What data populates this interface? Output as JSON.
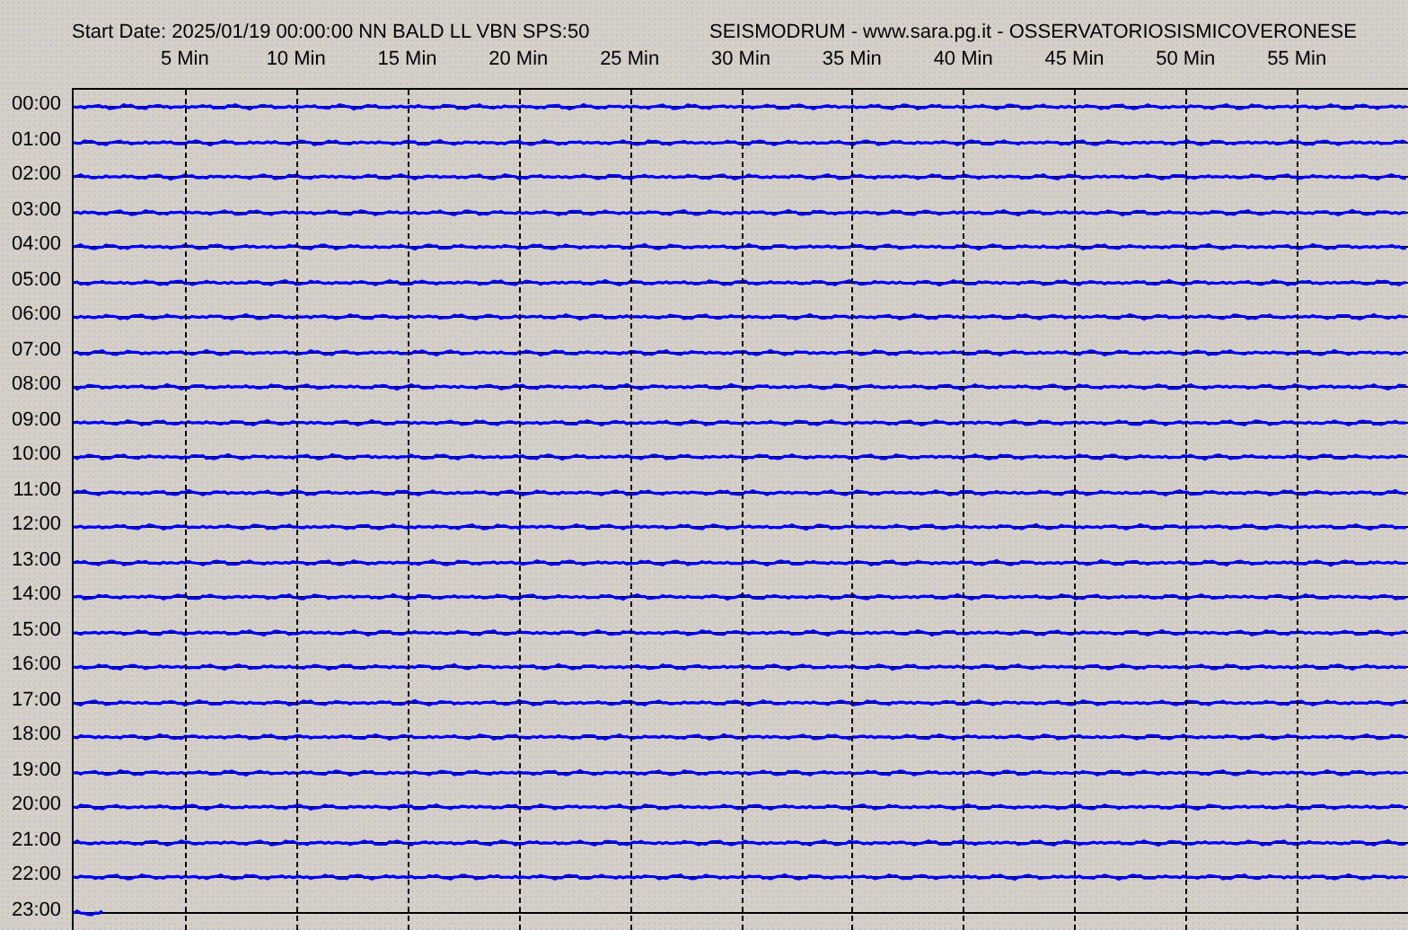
{
  "header": {
    "start_info": "Start Date: 2025/01/19 00:00:00 NN BALD LL VBN SPS:50",
    "title": "SEISMODRUM - www.sara.pg.it - OSSERVATORIOSISMICOVERONESE"
  },
  "minute_ticks": [
    "5 Min",
    "10 Min",
    "15 Min",
    "20 Min",
    "25 Min",
    "30 Min",
    "35 Min",
    "40 Min",
    "45 Min",
    "50 Min",
    "55 Min"
  ],
  "rows": [
    {
      "label": "00:00",
      "level": 1
    },
    {
      "label": "01:00",
      "level": 1
    },
    {
      "label": "02:00",
      "level": 1
    },
    {
      "label": "03:00",
      "level": 1
    },
    {
      "label": "04:00",
      "level": 1
    },
    {
      "label": "05:00",
      "level": 1
    },
    {
      "label": "06:00",
      "level": 1
    },
    {
      "label": "07:00",
      "level": 1
    },
    {
      "label": "08:00",
      "level": 1
    },
    {
      "label": "09:00",
      "level": 1
    },
    {
      "label": "10:00",
      "level": 1
    },
    {
      "label": "11:00",
      "level": 1
    },
    {
      "label": "12:00",
      "level": 1
    },
    {
      "label": "13:00",
      "level": 1
    },
    {
      "label": "14:00",
      "level": 1
    },
    {
      "label": "15:00",
      "level": 1
    },
    {
      "label": "16:00",
      "level": 1
    },
    {
      "label": "17:00",
      "level": 1
    },
    {
      "label": "18:00",
      "level": 1
    },
    {
      "label": "19:00",
      "level": 1
    },
    {
      "label": "20:00",
      "level": 1
    },
    {
      "label": "21:00",
      "level": 1
    },
    {
      "label": "22:00",
      "level": 1
    },
    {
      "label": "23:00",
      "level": 0.023
    }
  ]
}
